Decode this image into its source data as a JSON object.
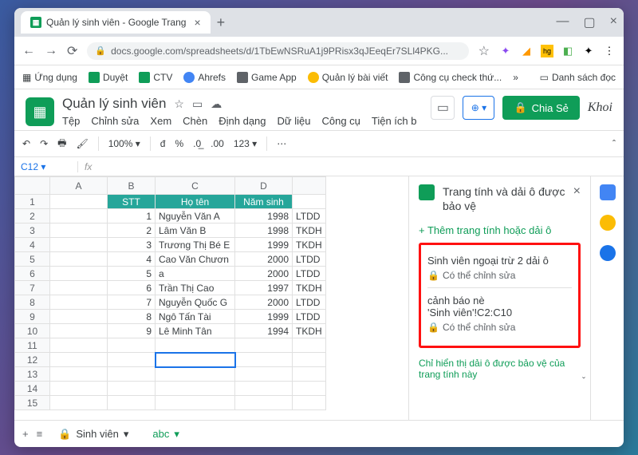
{
  "browser": {
    "tab_title": "Quản lý sinh viên - Google Trang",
    "url": "docs.google.com/spreadsheets/d/1TbEwNSRuA1j9PRisx3qJEeqEr7SLl4PKG..."
  },
  "bookmarks": {
    "apps": "Ứng dụng",
    "b1": "Duyệt",
    "b2": "CTV",
    "b3": "Ahrefs",
    "b4": "Game App",
    "b5": "Quản lý bài viết",
    "b6": "Công cụ check thứ...",
    "more": "»",
    "readlist": "Danh sách đọc"
  },
  "doc": {
    "title": "Quản lý sinh viên",
    "share": "Chia Sẻ",
    "avatar": "Khoi"
  },
  "menus": {
    "m1": "Tệp",
    "m2": "Chỉnh sửa",
    "m3": "Xem",
    "m4": "Chèn",
    "m5": "Định dạng",
    "m6": "Dữ liệu",
    "m7": "Công cụ",
    "m8": "Tiện ích b"
  },
  "toolbar": {
    "zoom": "100%",
    "currency": "đ",
    "pct": "%",
    "dec1": ".0",
    "dec2": ".00",
    "num": "123"
  },
  "cellref": "C12",
  "cols": {
    "A": "A",
    "B": "B",
    "C": "C",
    "D": "D"
  },
  "headers": {
    "b": "STT",
    "c": "Họ tên",
    "d": "Năm sinh"
  },
  "rows": [
    {
      "n": "1"
    },
    {
      "n": "2",
      "b": "1",
      "c": "Nguyễn Văn A",
      "d": "1998",
      "e": "LTDD"
    },
    {
      "n": "3",
      "b": "2",
      "c": "Lâm Văn B",
      "d": "1998",
      "e": "TKDH"
    },
    {
      "n": "4",
      "b": "3",
      "c": "Trương Thị Bé E",
      "d": "1999",
      "e": "TKDH"
    },
    {
      "n": "5",
      "b": "4",
      "c": "Cao Văn Chươn",
      "d": "2000",
      "e": "LTDD"
    },
    {
      "n": "6",
      "b": "5",
      "c": "a",
      "d": "2000",
      "e": "LTDD"
    },
    {
      "n": "7",
      "b": "6",
      "c": "Trần Thị Cao",
      "d": "1997",
      "e": "TKDH"
    },
    {
      "n": "8",
      "b": "7",
      "c": "Nguyễn Quốc G",
      "d": "2000",
      "e": "LTDD"
    },
    {
      "n": "9",
      "b": "8",
      "c": "Ngô Tấn Tài",
      "d": "1999",
      "e": "LTDD"
    },
    {
      "n": "10",
      "b": "9",
      "c": "Lê Minh Tân",
      "d": "1994",
      "e": "TKDH"
    },
    {
      "n": "11"
    },
    {
      "n": "12"
    },
    {
      "n": "13"
    },
    {
      "n": "14"
    },
    {
      "n": "15"
    }
  ],
  "panel": {
    "title": "Trang tính và dải ô được bảo vệ",
    "add": "+  Thêm trang tính hoặc dải ô",
    "r1_name": "Sinh viên ngoại trừ 2 dải ô",
    "r1_edit": "Có thể chỉnh sửa",
    "r2_name": "cảnh báo nè",
    "r2_ref": "'Sinh viên'!C2:C10",
    "r2_edit": "Có thể chỉnh sửa",
    "note": "Chỉ hiển thị dải ô được bảo vệ của trang tính này"
  },
  "bottom": {
    "s1": "Sinh viên",
    "s2": "abc"
  }
}
